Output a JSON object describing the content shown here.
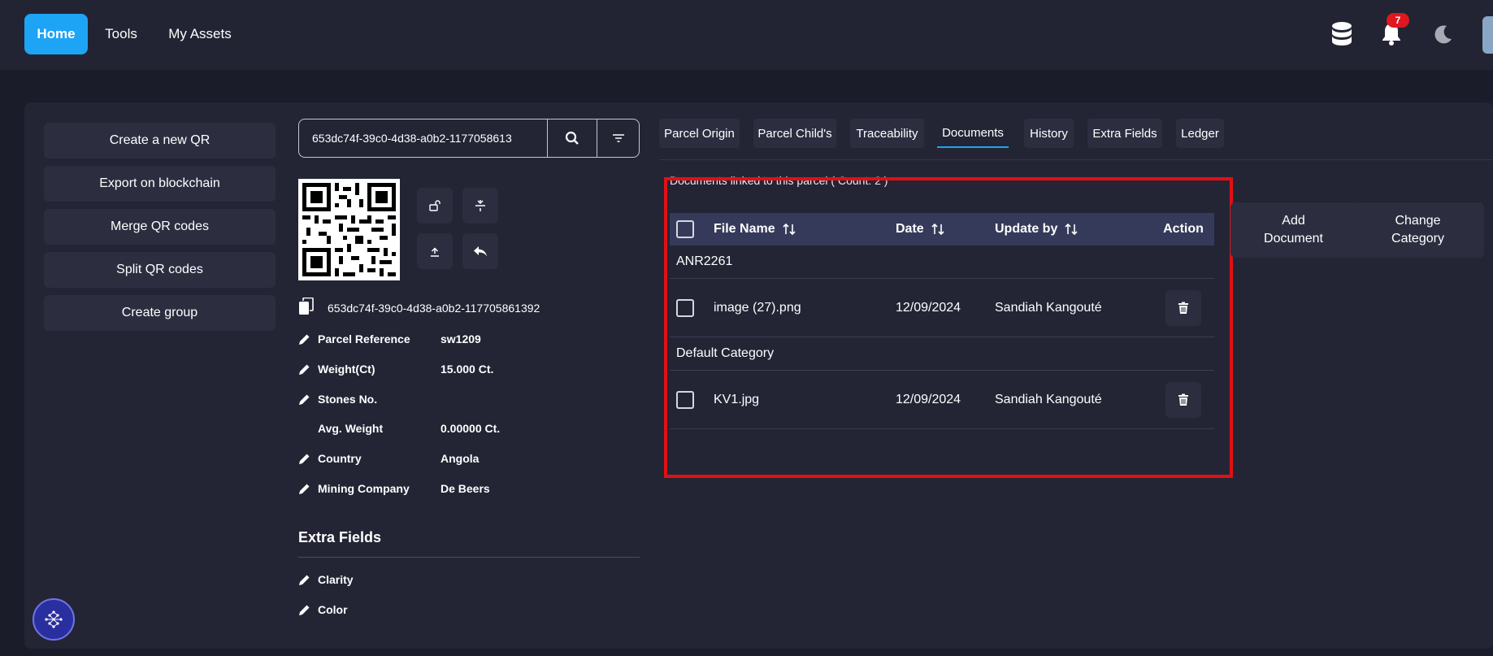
{
  "nav": {
    "home": "Home",
    "tools": "Tools",
    "assets": "My Assets",
    "notification_count": "7",
    "accent": "#1ea4f5",
    "badge_color": "#e0171f"
  },
  "actions": {
    "create_qr": "Create a new QR",
    "export": "Export on blockchain",
    "merge": "Merge QR codes",
    "split": "Split QR codes",
    "group": "Create group"
  },
  "search": {
    "value": "653dc74f-39c0-4d38-a0b2-1177058613"
  },
  "parcel": {
    "uuid": "653dc74f-39c0-4d38-a0b2-117705861392",
    "fields": [
      {
        "label": "Parcel Reference",
        "value": "sw1209"
      },
      {
        "label": "Weight(Ct)",
        "value": "15.000 Ct."
      },
      {
        "label": "Stones No.",
        "value": ""
      },
      {
        "label": "Avg. Weight",
        "value": "0.00000 Ct."
      },
      {
        "label": "Country",
        "value": "Angola"
      },
      {
        "label": "Mining Company",
        "value": "De Beers"
      }
    ]
  },
  "extra": {
    "title": "Extra Fields",
    "fields": [
      "Clarity",
      "Color"
    ]
  },
  "tabs": [
    "Parcel Origin",
    "Parcel Child's",
    "Traceability",
    "Documents",
    "History",
    "Extra Fields",
    "Ledger"
  ],
  "active_tab": "Documents",
  "documents": {
    "caption": "Documents linked to this parcel ( Count: 2 )",
    "headers": {
      "name": "File Name",
      "date": "Date",
      "user": "Update by",
      "action": "Action"
    },
    "groups": [
      {
        "name": "ANR2261",
        "rows": [
          {
            "name": "image (27).png",
            "date": "12/09/2024",
            "user": "Sandiah Kangouté"
          }
        ]
      },
      {
        "name": "Default Category",
        "rows": [
          {
            "name": "KV1.jpg",
            "date": "12/09/2024",
            "user": "Sandiah Kangouté"
          }
        ]
      }
    ],
    "add_document": "Add Document",
    "change_category": "Change Category",
    "highlight_color": "#e30f13"
  }
}
